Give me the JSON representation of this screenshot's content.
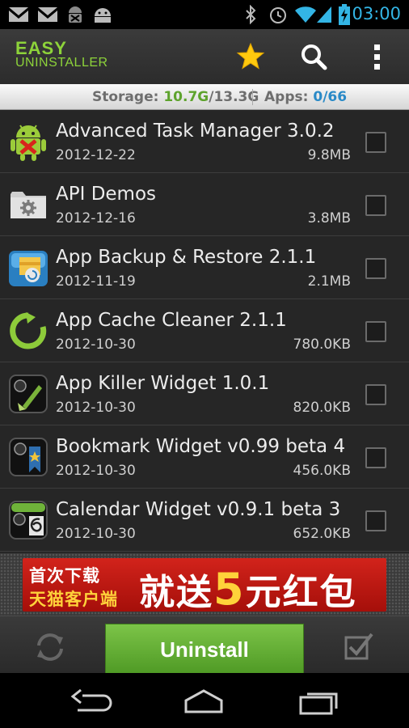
{
  "status_bar": {
    "time": "03:00",
    "icons": [
      "gmail-icon",
      "gmail-icon",
      "android-debug-icon",
      "android-icon",
      "bluetooth-icon",
      "alarm-icon",
      "wifi-icon",
      "signal-icon",
      "battery-charging-icon"
    ]
  },
  "app_bar": {
    "logo_line1": "EASY",
    "logo_line2": "UNINSTALLER",
    "actions": [
      "star-icon",
      "search-icon",
      "overflow-menu-icon"
    ]
  },
  "info_bar": {
    "storage_label": "Storage: ",
    "storage_used": "10.7G",
    "storage_total": "/13.3G",
    "apps_label": "Apps: ",
    "apps_selected": "0",
    "apps_total": "/66"
  },
  "apps": [
    {
      "name": "Advanced Task Manager 3.0.2",
      "date": "2012-12-22",
      "size": "9.8MB",
      "icon": "task-manager-icon",
      "checked": false
    },
    {
      "name": "API Demos",
      "date": "2012-12-16",
      "size": "3.8MB",
      "icon": "folder-gear-icon",
      "checked": false
    },
    {
      "name": "App Backup & Restore 2.1.1",
      "date": "2012-11-19",
      "size": "2.1MB",
      "icon": "backup-restore-icon",
      "checked": false
    },
    {
      "name": "App Cache Cleaner 2.1.1",
      "date": "2012-10-30",
      "size": "780.0KB",
      "icon": "cache-cleaner-icon",
      "checked": false
    },
    {
      "name": "App Killer Widget 1.0.1",
      "date": "2012-10-30",
      "size": "820.0KB",
      "icon": "app-killer-icon",
      "checked": false
    },
    {
      "name": "Bookmark Widget v0.99 beta 4",
      "date": "2012-10-30",
      "size": "456.0KB",
      "icon": "bookmark-widget-icon",
      "checked": false
    },
    {
      "name": "Calendar Widget v0.9.1 beta 3",
      "date": "2012-10-30",
      "size": "652.0KB",
      "icon": "calendar-widget-icon",
      "checked": false
    }
  ],
  "ad_banner": {
    "line1": "首次下载",
    "line2": "天猫客户端",
    "big_pre": "就送",
    "big_num": "5",
    "big_post": "元红包"
  },
  "bottom_bar": {
    "uninstall_label": "Uninstall",
    "icons": [
      "refresh-icon",
      "select-all-icon"
    ]
  },
  "nav_bar": {
    "icons": [
      "back-icon",
      "home-icon",
      "recent-apps-icon"
    ]
  },
  "colors": {
    "accent_green": "#8dd33a",
    "holo_blue": "#33b5e5",
    "uninstall_green": "#5fae33",
    "ad_red": "#c41a14",
    "ad_yellow": "#ffd23a"
  }
}
